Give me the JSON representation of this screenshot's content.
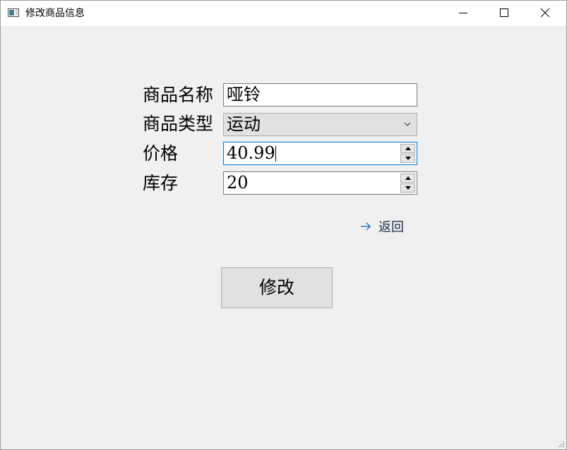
{
  "window": {
    "title": "修改商品信息"
  },
  "form": {
    "name_label": "商品名称",
    "name_value": "哑铃",
    "type_label": "商品类型",
    "type_value": "运动",
    "price_label": "价格",
    "price_value": "40.99",
    "stock_label": "库存",
    "stock_value": "20"
  },
  "actions": {
    "back_label": "返回",
    "modify_label": "修改"
  },
  "colors": {
    "focus_border": "#0078d7",
    "link_arrow": "#1e73be",
    "window_bg": "#f0f0f0"
  },
  "icons": [
    "app-icon",
    "minimize-icon",
    "maximize-icon",
    "close-icon",
    "chevron-down-icon",
    "spin-up-icon",
    "spin-down-icon",
    "arrow-right-icon",
    "resize-grip-icon"
  ]
}
